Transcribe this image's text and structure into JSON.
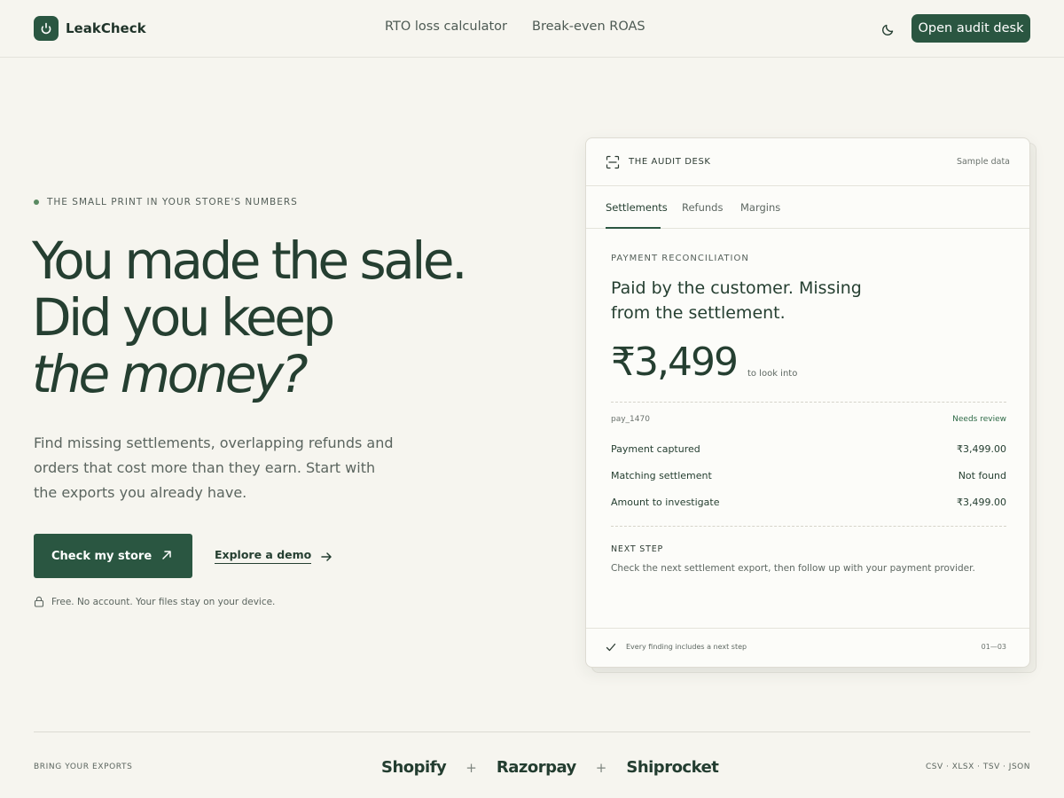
{
  "header": {
    "brand": "LeakCheck",
    "nav": [
      "RTO loss calculator",
      "Break-even ROAS"
    ],
    "theme_icon": "moon-icon",
    "cta": "Open audit desk"
  },
  "hero": {
    "eyebrow": "THE SMALL PRINT IN YOUR STORE'S NUMBERS",
    "headline_line1": "You made the sale.",
    "headline_line2": "Did you keep",
    "headline_line3": "the money?",
    "lede": "Find missing settlements, overlapping refunds and orders that cost more than they earn. Start with the exports you already have.",
    "primary_cta": "Check my store",
    "secondary_cta": "Explore a demo",
    "fineprint": "Free. No account. Your files stay on your device."
  },
  "audit_card": {
    "title": "THE AUDIT DESK",
    "badge": "Sample data",
    "tabs": [
      "Settlements",
      "Refunds",
      "Margins"
    ],
    "active_tab": "Settlements",
    "section_label": "PAYMENT RECONCILIATION",
    "finding_title": "Paid by the customer. Missing from the settlement.",
    "amount": "₹3,499",
    "amount_note": "to look into",
    "payment_id": "pay_1470",
    "status": "Needs review",
    "rows": [
      {
        "label": "Payment captured",
        "value": "₹3,499.00"
      },
      {
        "label": "Matching settlement",
        "value": "Not found"
      },
      {
        "label": "Amount to investigate",
        "value": "₹3,499.00"
      }
    ],
    "next_step_label": "NEXT STEP",
    "next_step_text": "Check the next settlement export, then follow up with your payment provider.",
    "footer_note": "Every finding includes a next step",
    "pager": "01—03"
  },
  "exports": {
    "label": "BRING YOUR EXPORTS",
    "brands": [
      "Shopify",
      "Razorpay",
      "Shiprocket"
    ],
    "formats": "CSV · XLSX · TSV · JSON"
  },
  "colors": {
    "brand_green": "#2a5641",
    "background": "#f6f5ef",
    "text_dark": "#233d30"
  }
}
